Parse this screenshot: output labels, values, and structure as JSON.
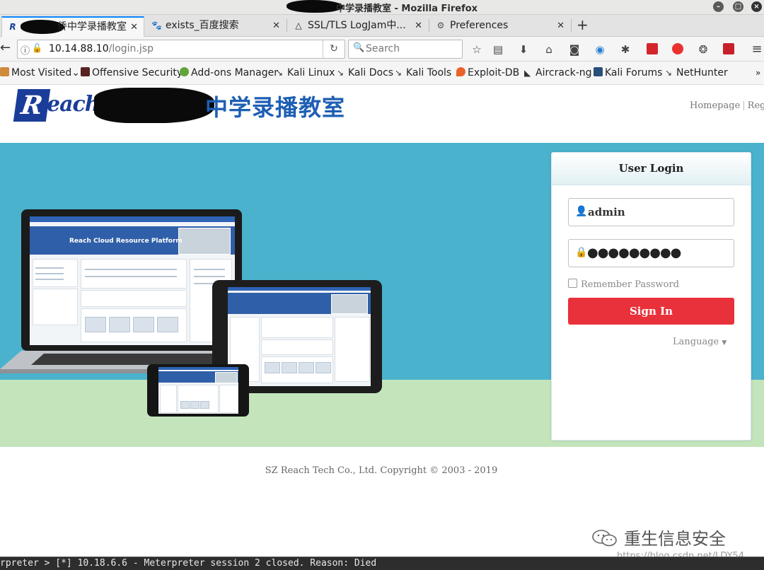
{
  "window": {
    "title": "中学录播教室 - Mozilla Firefox",
    "controls": [
      "minimize",
      "maximize",
      "close"
    ]
  },
  "tabs": [
    {
      "label": "侨中学录播教室",
      "icon": "reach-favicon",
      "active": true
    },
    {
      "label": "exists_百度搜索",
      "icon": "baidu-paw-icon",
      "active": false
    },
    {
      "label": "SSL/TLS LogJam中...",
      "icon": "linux-penguin-icon",
      "active": false
    },
    {
      "label": "Preferences",
      "icon": "gear-icon",
      "active": false
    }
  ],
  "toolbar": {
    "url_host": "10.14.88.10",
    "url_path": "/login.jsp",
    "search_placeholder": "Search"
  },
  "bookmarks": [
    {
      "label": "Most Visited",
      "icon": "most-visited-icon"
    },
    {
      "label": "Offensive Security",
      "icon": "offsec-icon"
    },
    {
      "label": "Add-ons Manager",
      "icon": "puzzle-icon"
    },
    {
      "label": "Kali Linux",
      "icon": "kali-dragon-icon"
    },
    {
      "label": "Kali Docs",
      "icon": "kali-dragon-icon"
    },
    {
      "label": "Kali Tools",
      "icon": "kali-dragon-icon"
    },
    {
      "label": "Exploit-DB",
      "icon": "exploitdb-icon"
    },
    {
      "label": "Aircrack-ng",
      "icon": "aircrack-icon"
    },
    {
      "label": "Kali Forums",
      "icon": "kali-forums-icon"
    },
    {
      "label": "NetHunter",
      "icon": "kali-dragon-icon"
    }
  ],
  "header": {
    "logo_r": "R",
    "logo_rest": "each",
    "school_title": "中学录播教室",
    "nav_homepage": "Homepage",
    "nav_sep": "|",
    "nav_register": "Regis"
  },
  "hero": {
    "screen_text": "Reach Cloud Resource Platform"
  },
  "login": {
    "title": "User Login",
    "username": "admin",
    "password_mask": "●●●●●●●●●",
    "remember_label": "Remember Password",
    "remember_checked": false,
    "signin_label": "Sign In",
    "language_label": "Language",
    "signin_color": "#e8313a"
  },
  "footer": {
    "copyright": "SZ Reach Tech Co., Ltd. Copyright © 2003 - 2019"
  },
  "watermark": {
    "cn": "重生信息安全",
    "url": "https://blog.csdn.net/LDY54"
  },
  "terminal": {
    "line": "rpreter > [*] 10.18.6.6 - Meterpreter session 2 closed.  Reason: Died"
  },
  "colors": {
    "hero_blue": "#4ab2cc",
    "hero_green": "#c4e4bc",
    "brand_blue": "#1a3d99",
    "title_blue": "#1e5fb4",
    "firefox_accent": "#0a84ff"
  }
}
